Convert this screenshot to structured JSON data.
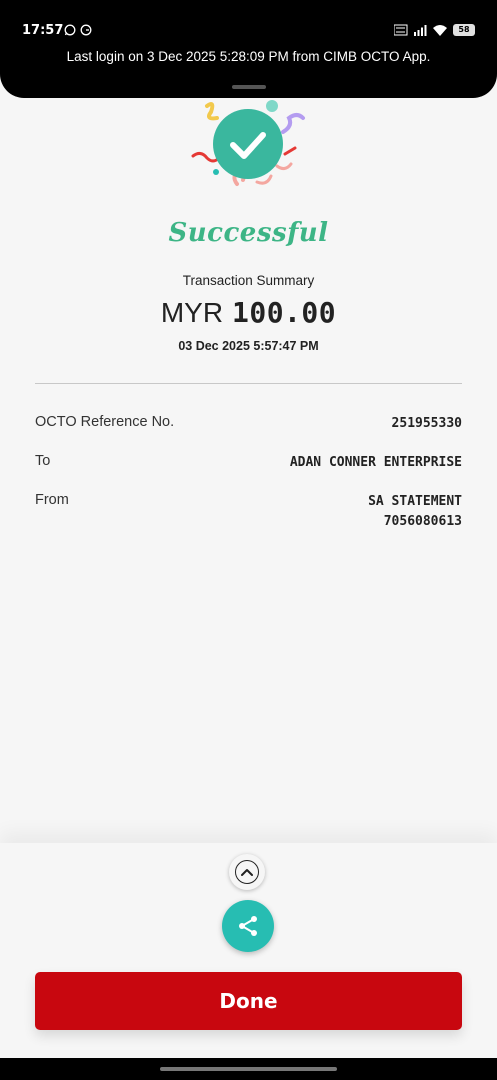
{
  "status_bar": {
    "time": "17:57",
    "battery": "58",
    "icons": [
      "whatsapp-icon",
      "g-icon",
      "volte-icon",
      "4g-signal-icon",
      "wifi-icon",
      "battery-icon"
    ]
  },
  "banner": {
    "login_text": "Last login on 3 Dec 2025 5:28:09 PM from CIMB OCTO App."
  },
  "result": {
    "title": "Successful",
    "summary_label": "Transaction Summary",
    "currency": "MYR",
    "amount": "100.00",
    "datetime": "03 Dec 2025 5:57:47 PM"
  },
  "details": [
    {
      "label": "OCTO Reference No.",
      "value_lines": [
        "251955330"
      ]
    },
    {
      "label": "To",
      "value_lines": [
        "ADAN CONNER ENTERPRISE"
      ]
    },
    {
      "label": "From",
      "value_lines": [
        "SA STATEMENT",
        "7056080613"
      ]
    }
  ],
  "actions": {
    "done_label": "Done",
    "share_icon": "share-icon",
    "expand_icon": "chevron-up-icon"
  },
  "colors": {
    "success_green": "#3db586",
    "brand_red": "#c8070f",
    "share_teal": "#27bdb2"
  }
}
